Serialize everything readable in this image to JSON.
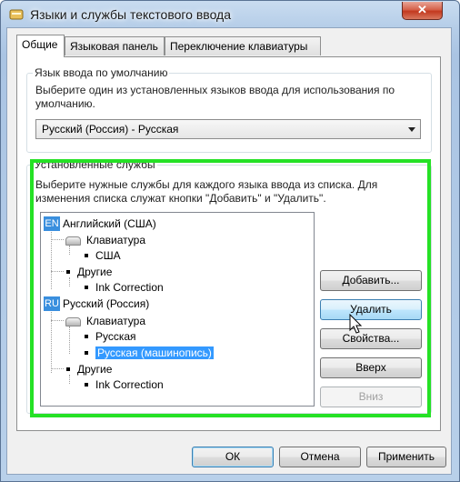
{
  "window": {
    "title": "Языки и службы текстового ввода",
    "close_glyph": "✕"
  },
  "tabs": [
    {
      "label": "Общие"
    },
    {
      "label": "Языковая панель"
    },
    {
      "label": "Переключение клавиатуры"
    }
  ],
  "default_language": {
    "group_label": "Язык ввода по умолчанию",
    "description": "Выберите один из установленных языков ввода для использования по умолчанию.",
    "selected": "Русский (Россия) - Русская"
  },
  "installed_services": {
    "group_label": "Установленные службы",
    "description": "Выберите нужные службы для каждого языка ввода из списка. Для изменения списка служат кнопки \"Добавить\" и \"Удалить\".",
    "tree": {
      "en_badge": "EN",
      "en_label": "Английский (США)",
      "en_keyboard": "Клавиатура",
      "en_keyboard_item": "США",
      "en_other": "Другие",
      "en_other_item": "Ink Correction",
      "ru_badge": "RU",
      "ru_label": "Русский (Россия)",
      "ru_keyboard": "Клавиатура",
      "ru_keyboard_item1": "Русская",
      "ru_keyboard_item2": "Русская (машинопись)",
      "ru_other": "Другие",
      "ru_other_item": "Ink Correction"
    },
    "buttons": {
      "add": "Добавить...",
      "remove": "Удалить",
      "properties": "Свойства...",
      "up": "Вверх",
      "down": "Вниз"
    }
  },
  "footer": {
    "ok": "ОК",
    "cancel": "Отмена",
    "apply": "Применить"
  },
  "colors": {
    "highlight": "#25e125",
    "selection": "#3399ff",
    "badge": "#3a8fde"
  }
}
